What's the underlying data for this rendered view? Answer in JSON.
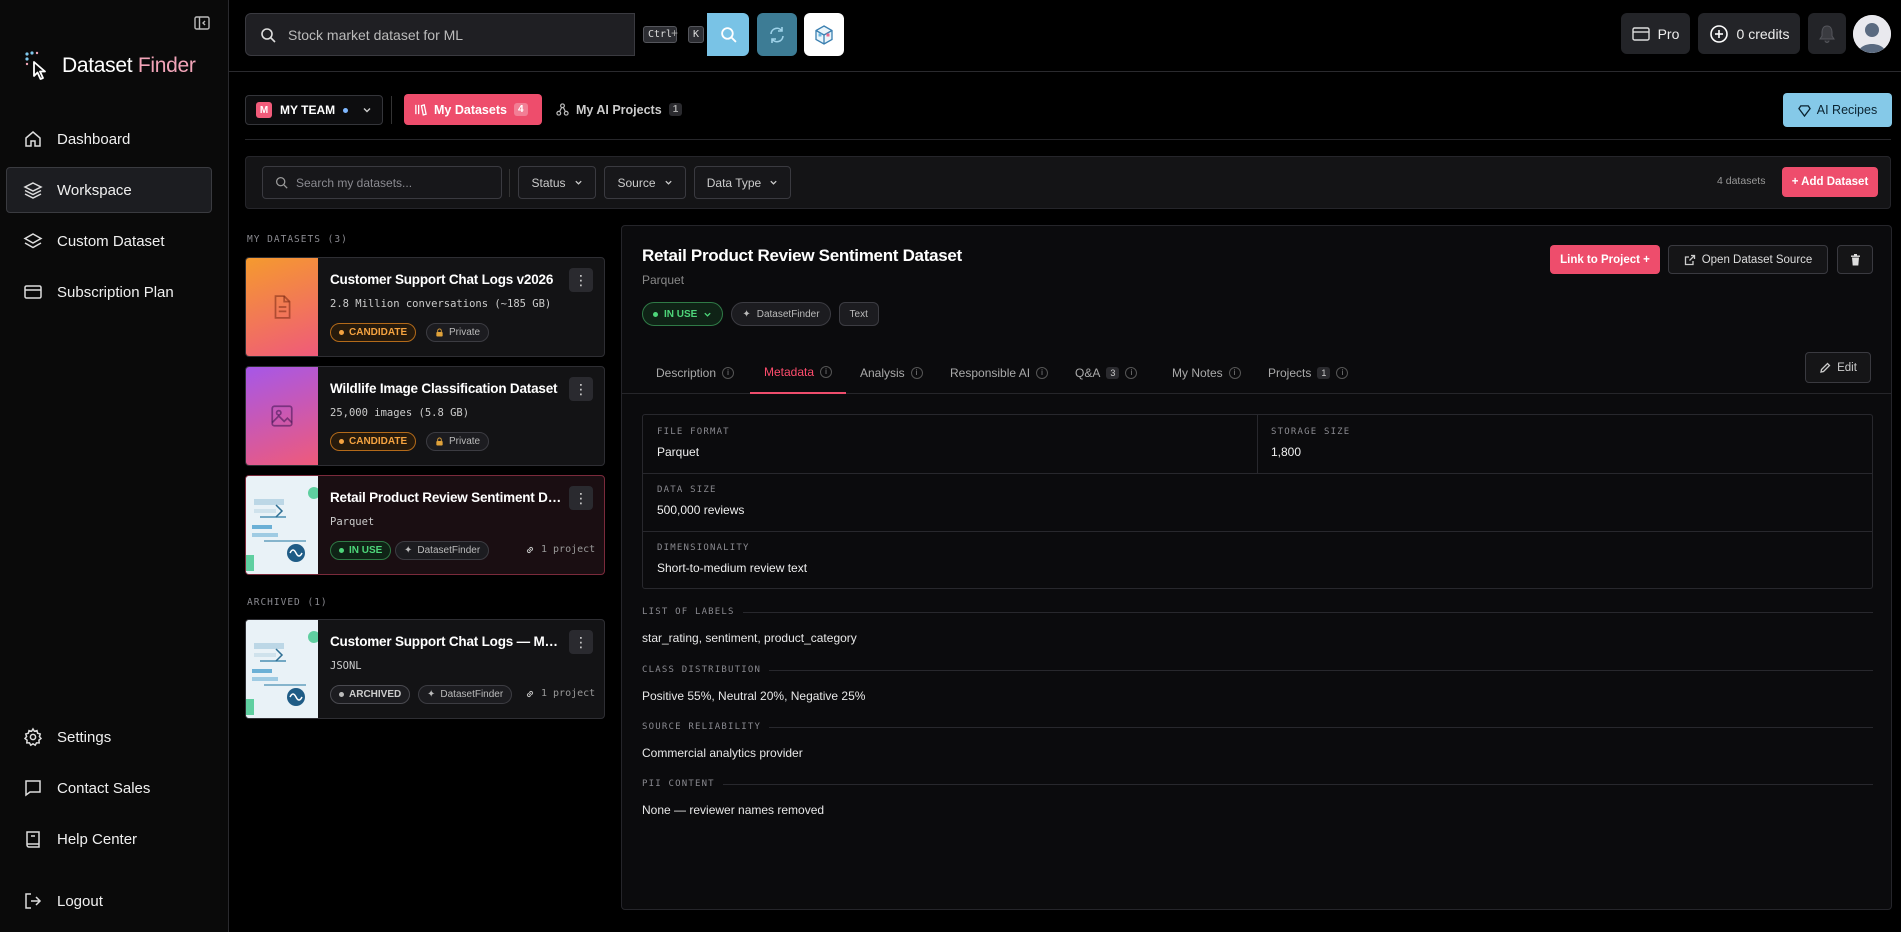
{
  "app": {
    "name_main": "Dataset",
    "name_accent": " Finder"
  },
  "sidebar": {
    "items": [
      {
        "label": "Dashboard",
        "icon": "home-icon"
      },
      {
        "label": "Workspace",
        "icon": "layers-icon"
      },
      {
        "label": "Custom Dataset",
        "icon": "layers-icon"
      },
      {
        "label": "Subscription Plan",
        "icon": "card-icon"
      }
    ],
    "bottom": [
      {
        "label": "Settings",
        "icon": "gear-icon"
      },
      {
        "label": "Contact Sales",
        "icon": "chat-icon"
      },
      {
        "label": "Help Center",
        "icon": "book-icon"
      }
    ],
    "logout": "Logout"
  },
  "topbar": {
    "search_placeholder": "Stock market dataset for ML",
    "kbd_ctrl": "Ctrl",
    "kbd_plus": "+",
    "kbd_k": "K",
    "pro_label": "Pro",
    "credits_label": "0 credits"
  },
  "team": {
    "badge": "M",
    "name": "MY TEAM"
  },
  "tabs": {
    "my_datasets": "My Datasets",
    "my_datasets_count": "4",
    "my_projects": "My AI Projects",
    "my_projects_count": "1",
    "ai_recipes": "AI Recipes"
  },
  "filters": {
    "search_placeholder": "Search my datasets...",
    "status": "Status",
    "source": "Source",
    "data_type": "Data Type",
    "count_text": "4 datasets",
    "add_button": "+ Add Dataset"
  },
  "list": {
    "my_datasets_label": "MY DATASETS (3)",
    "archived_label": "ARCHIVED (1)",
    "cards": [
      {
        "title": "Customer Support Chat Logs v2026",
        "sub": "2.8 Million conversations (~185 GB)",
        "badge1": "CANDIDATE",
        "badge2": "Private"
      },
      {
        "title": "Wildlife Image Classification Dataset",
        "sub": "25,000 images (5.8 GB)",
        "badge1": "CANDIDATE",
        "badge2": "Private"
      },
      {
        "title": "Retail Product Review Sentiment Dataset",
        "sub": "Parquet",
        "badge1": "IN USE",
        "badge2": "DatasetFinder",
        "projects": "1 project"
      },
      {
        "title": "Customer Support Chat Logs — Multilingual",
        "sub": "JSONL",
        "badge1": "ARCHIVED",
        "badge2": "DatasetFinder",
        "projects": "1 project"
      }
    ]
  },
  "detail": {
    "title": "Retail Product Review Sentiment Dataset",
    "subtitle": "Parquet",
    "status": "IN USE",
    "source": "DatasetFinder",
    "type": "Text",
    "link_button": "Link to Project +",
    "open_button": "Open Dataset Source",
    "edit_button": "Edit",
    "tabs": [
      {
        "label": "Description"
      },
      {
        "label": "Metadata"
      },
      {
        "label": "Analysis"
      },
      {
        "label": "Responsible AI"
      },
      {
        "label": "Q&A",
        "count": "3"
      },
      {
        "label": "My Notes"
      },
      {
        "label": "Projects",
        "count": "1"
      }
    ],
    "info_glyph": "i",
    "metadata": {
      "file_format_label": "FILE FORMAT",
      "file_format": "Parquet",
      "storage_size_label": "STORAGE SIZE",
      "storage_size": "1,800",
      "data_size_label": "DATA SIZE",
      "data_size": "500,000 reviews",
      "dimensionality_label": "DIMENSIONALITY",
      "dimensionality": "Short-to-medium review text",
      "labels_label": "LIST OF LABELS",
      "labels": "star_rating, sentiment, product_category",
      "class_dist_label": "CLASS DISTRIBUTION",
      "class_dist": "Positive 55%, Neutral 20%, Negative 25%",
      "reliability_label": "SOURCE RELIABILITY",
      "reliability": "Commercial analytics provider",
      "pii_label": "PII CONTENT",
      "pii": "None — reviewer names removed"
    }
  },
  "colors": {
    "accent": "#ee4d6c",
    "cyan": "#79c3e6",
    "in_use": "#4ed67a",
    "candidate": "#f5a340"
  }
}
